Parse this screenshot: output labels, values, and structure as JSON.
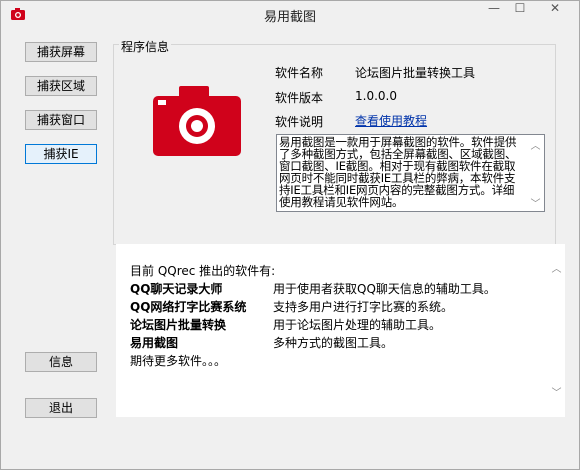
{
  "window": {
    "title": "易用截图"
  },
  "titlebar": {
    "minimize": "—",
    "maximize": "☐",
    "close": "✕"
  },
  "sidebar": {
    "buttons": [
      {
        "label": "捕获屏幕"
      },
      {
        "label": "捕获区域"
      },
      {
        "label": "捕获窗口"
      },
      {
        "label": "捕获IE"
      }
    ],
    "info_button": "信息",
    "exit_button": "退出"
  },
  "program_info": {
    "legend": "程序信息",
    "name_label": "软件名称",
    "name_value": "论坛图片批量转换工具",
    "version_label": "软件版本",
    "version_value": "1.0.0.0",
    "desc_label": "软件说明",
    "desc_link": "查看使用教程",
    "description": "易用截图是一款用于屏幕截图的软件。软件提供了多种截图方式，包括全屏幕截图、区域截图、窗口截图、IE截图。相对于现有截图软件在截取网页时不能同时截获IE工具栏的弊病，本软件支持IE工具栏和IE网页内容的完整截图方式。详细使用教程请见软件网站。"
  },
  "products": {
    "intro": "目前 QQrec 推出的软件有:",
    "items": [
      {
        "name": "QQ聊天记录大师",
        "desc": "用于使用者获取QQ聊天信息的辅助工具。"
      },
      {
        "name": "QQ网络打字比赛系统",
        "desc": "支持多用户进行打字比赛的系统。"
      },
      {
        "name": "论坛图片批量转换",
        "desc": "用于论坛图片处理的辅助工具。"
      },
      {
        "name": "易用截图",
        "desc": "多种方式的截图工具。"
      }
    ],
    "footer": "期待更多软件。。。"
  },
  "colors": {
    "camera": "#d0021b",
    "link": "#0033aa",
    "focus": "#0078d7"
  }
}
